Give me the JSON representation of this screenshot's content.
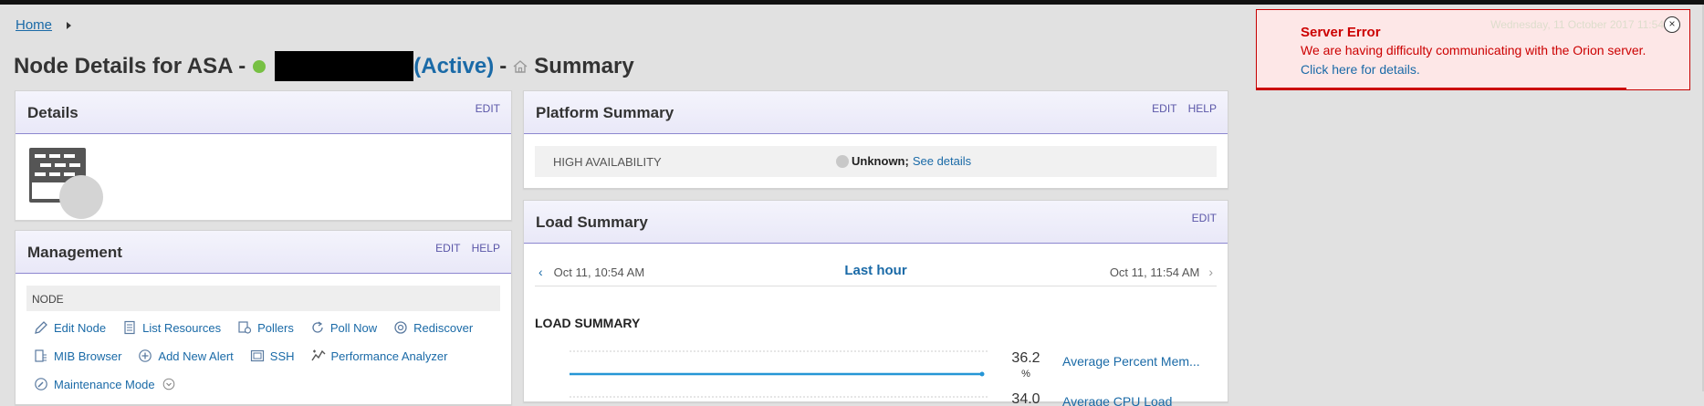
{
  "breadcrumb": {
    "home": "Home"
  },
  "title": {
    "prefix": "Node Details for ASA -",
    "status": "(Active)",
    "dash": "-",
    "view": "Summary"
  },
  "details": {
    "title": "Details",
    "edit": "EDIT"
  },
  "platform": {
    "title": "Platform Summary",
    "edit": "EDIT",
    "help": "HELP",
    "ha_label": "HIGH AVAILABILITY",
    "ha_status": "Unknown;",
    "ha_link": "See details"
  },
  "load": {
    "title": "Load Summary",
    "edit": "EDIT",
    "start": "Oct 11, 10:54 AM",
    "range": "Last hour",
    "end": "Oct 11, 11:54 AM",
    "heading": "LOAD SUMMARY",
    "metrics": [
      {
        "value": "36.2",
        "unit": "%",
        "label": "Average Percent Mem..."
      },
      {
        "value": "34.0",
        "label": "Average CPU Load"
      }
    ]
  },
  "management": {
    "title": "Management",
    "edit": "EDIT",
    "help": "HELP",
    "section": "NODE",
    "links_row1": [
      "Edit Node",
      "List Resources",
      "Pollers",
      "Poll Now",
      "Rediscover"
    ],
    "links_row2": [
      "MIB Browser",
      "Add New Alert",
      "SSH",
      "Performance Analyzer"
    ],
    "links_row3": [
      "Maintenance Mode"
    ]
  },
  "error": {
    "title": "Server Error",
    "message": "We are having difficulty communicating with the Orion server.",
    "link": "Click here for details.",
    "date": "Wednesday, 11 October 2017 11:54",
    "close": "×"
  },
  "colors": {
    "accent": "#1a6aa7",
    "status_up": "#77c043",
    "error": "#c60000"
  }
}
